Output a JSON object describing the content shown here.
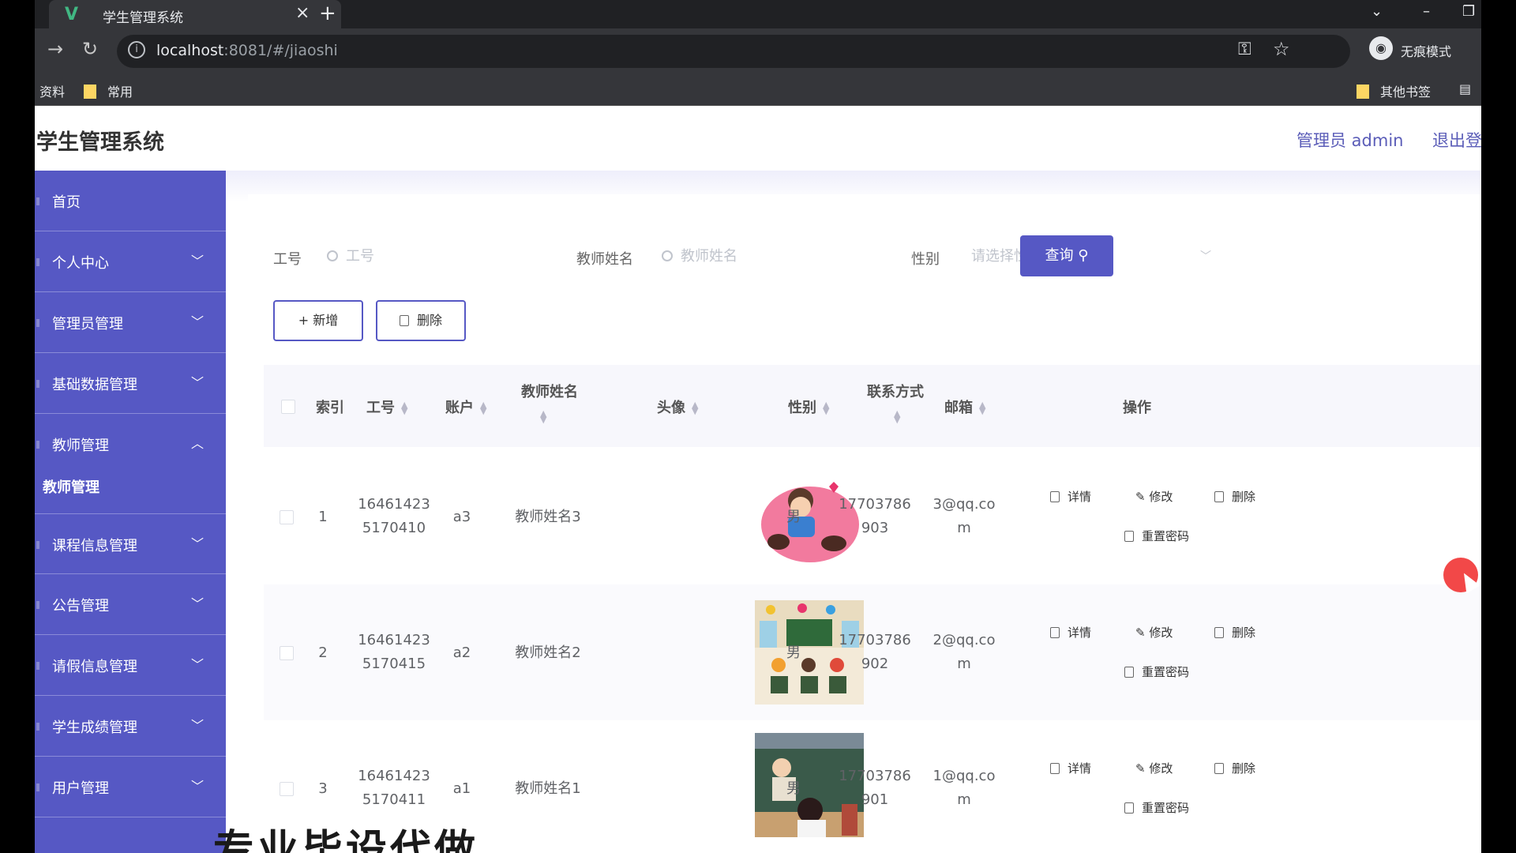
{
  "browser": {
    "tab_title": "学生管理系统",
    "url_host": "localhost",
    "url_rest": ":8081/#/jiaoshi",
    "incognito_label": "无痕模式",
    "bookmarks": [
      "资料",
      "常用"
    ],
    "other_bookmarks": "其他书签"
  },
  "header": {
    "title": "学生管理系统",
    "user": "管理员 admin",
    "logout": "退出登"
  },
  "sidebar": {
    "items": [
      {
        "label": "首页"
      },
      {
        "label": "个人中心"
      },
      {
        "label": "管理员管理"
      },
      {
        "label": "基础数据管理"
      },
      {
        "label": "教师管理"
      },
      {
        "label": "课程信息管理"
      },
      {
        "label": "公告管理"
      },
      {
        "label": "请假信息管理"
      },
      {
        "label": "学生成绩管理"
      },
      {
        "label": "用户管理"
      }
    ],
    "active_sub": "教师管理"
  },
  "search": {
    "job_no_label": "工号",
    "job_no_placeholder": "工号",
    "name_label": "教师姓名",
    "name_placeholder": "教师姓名",
    "gender_label": "性别",
    "gender_placeholder": "请选择性别",
    "query_label": "查询"
  },
  "toolbar": {
    "add_label": "+ 新增",
    "delete_label": "删除"
  },
  "table": {
    "headers": {
      "index": "索引",
      "job_no": "工号",
      "account": "账户",
      "name": "教师姓名",
      "avatar": "头像",
      "gender": "性别",
      "contact": "联系方式",
      "email": "邮箱",
      "actions": "操作"
    },
    "actions": {
      "detail": "详情",
      "edit": "修改",
      "delete": "删除",
      "reset": "重置密码"
    },
    "rows": [
      {
        "index": "1",
        "job_no_a": "16461423",
        "job_no_b": "5170410",
        "account": "a3",
        "name": "教师姓名3",
        "gender": "男",
        "phone_a": "17703786",
        "phone_b": "903",
        "email_a": "3@qq.co",
        "email_b": "m"
      },
      {
        "index": "2",
        "job_no_a": "16461423",
        "job_no_b": "5170415",
        "account": "a2",
        "name": "教师姓名2",
        "gender": "男",
        "phone_a": "17703786",
        "phone_b": "902",
        "email_a": "2@qq.co",
        "email_b": "m"
      },
      {
        "index": "3",
        "job_no_a": "16461423",
        "job_no_b": "5170411",
        "account": "a1",
        "name": "教师姓名1",
        "gender": "男",
        "phone_a": "17703786",
        "phone_b": "901",
        "email_a": "1@qq.co",
        "email_b": "m"
      }
    ]
  },
  "overlay": "专业毕设代做"
}
